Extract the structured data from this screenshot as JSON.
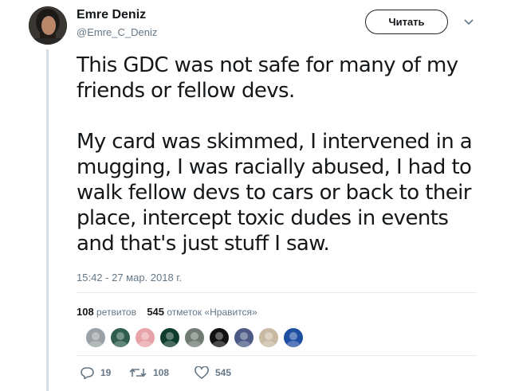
{
  "author": {
    "name": "Emre Deniz",
    "handle": "@Emre_C_Deniz"
  },
  "follow_button": {
    "label": "Читать"
  },
  "tweet": {
    "paragraphs": [
      "This GDC was not safe for many of my friends or fellow devs.",
      "My card was skimmed, I intervened in a mugging, I was racially abused, I had to walk fellow devs to cars or back to their place, intercept toxic dudes in events and that's just stuff I saw."
    ],
    "timestamp": "15:42 - 27 мар. 2018 г."
  },
  "stats": {
    "retweets_count": "108",
    "retweets_label": "ретвитов",
    "likes_count": "545",
    "likes_label": "отметок «Нравится»"
  },
  "likers": [
    {
      "icon": "liker-avatar-1",
      "color": "#9aa0a3"
    },
    {
      "icon": "liker-avatar-2",
      "color": "#2f5e4e"
    },
    {
      "icon": "liker-avatar-3",
      "color": "#e8a3a9"
    },
    {
      "icon": "liker-avatar-4",
      "color": "#0f3d2c"
    },
    {
      "icon": "liker-avatar-5",
      "color": "#6e7a72"
    },
    {
      "icon": "liker-avatar-6",
      "color": "#111111"
    },
    {
      "icon": "liker-avatar-7",
      "color": "#4b5a84"
    },
    {
      "icon": "liker-avatar-8",
      "color": "#c9b9a3"
    },
    {
      "icon": "liker-avatar-9",
      "color": "#1f4fa3"
    }
  ],
  "actions": {
    "reply_count": "19",
    "retweet_count": "108",
    "like_count": "545"
  },
  "colors": {
    "text": "#14171a",
    "secondary": "#657786",
    "divider": "#e6ecf0",
    "thread_line": "#d8dfe4"
  }
}
